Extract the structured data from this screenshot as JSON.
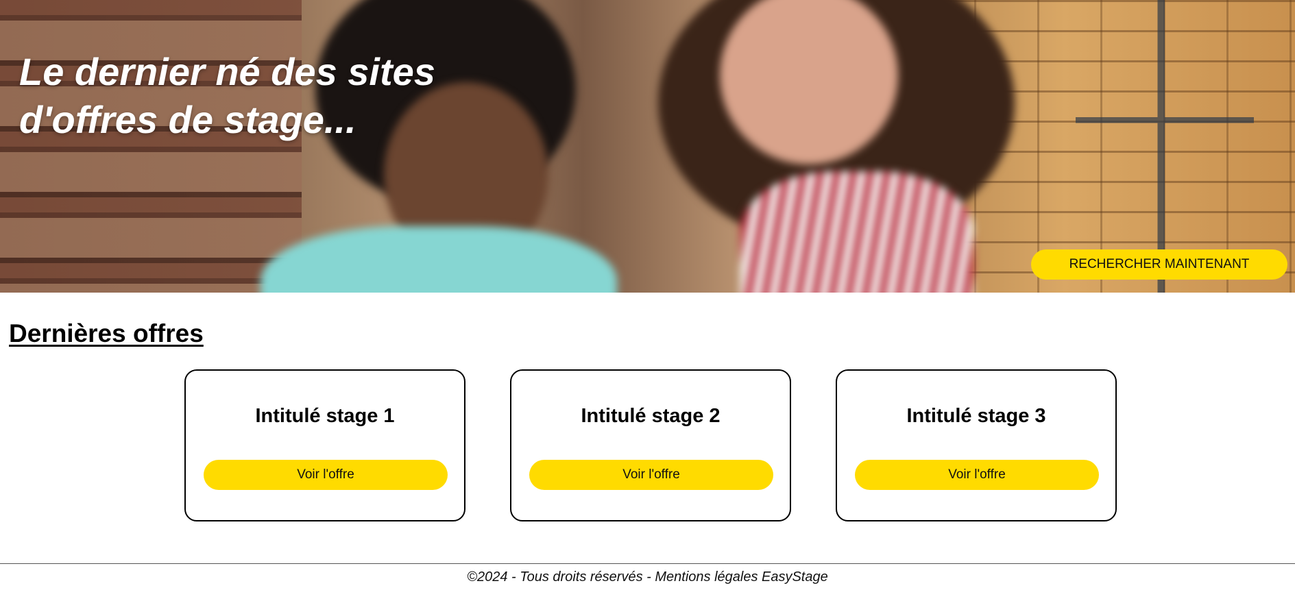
{
  "hero": {
    "title": "Le dernier né des sites d'offres de stage...",
    "cta_label": "RECHERCHER MAINTENANT"
  },
  "latest_offers": {
    "title": "Dernières offres",
    "cards": [
      {
        "title": "Intitulé stage 1",
        "button_label": "Voir l'offre"
      },
      {
        "title": "Intitulé stage 2",
        "button_label": "Voir l'offre"
      },
      {
        "title": "Intitulé stage 3",
        "button_label": "Voir l'offre"
      }
    ]
  },
  "footer": {
    "text": "©2024 - Tous droits réservés - Mentions légales EasyStage"
  },
  "colors": {
    "accent": "#ffdb00",
    "text": "#000000",
    "background": "#ffffff"
  }
}
